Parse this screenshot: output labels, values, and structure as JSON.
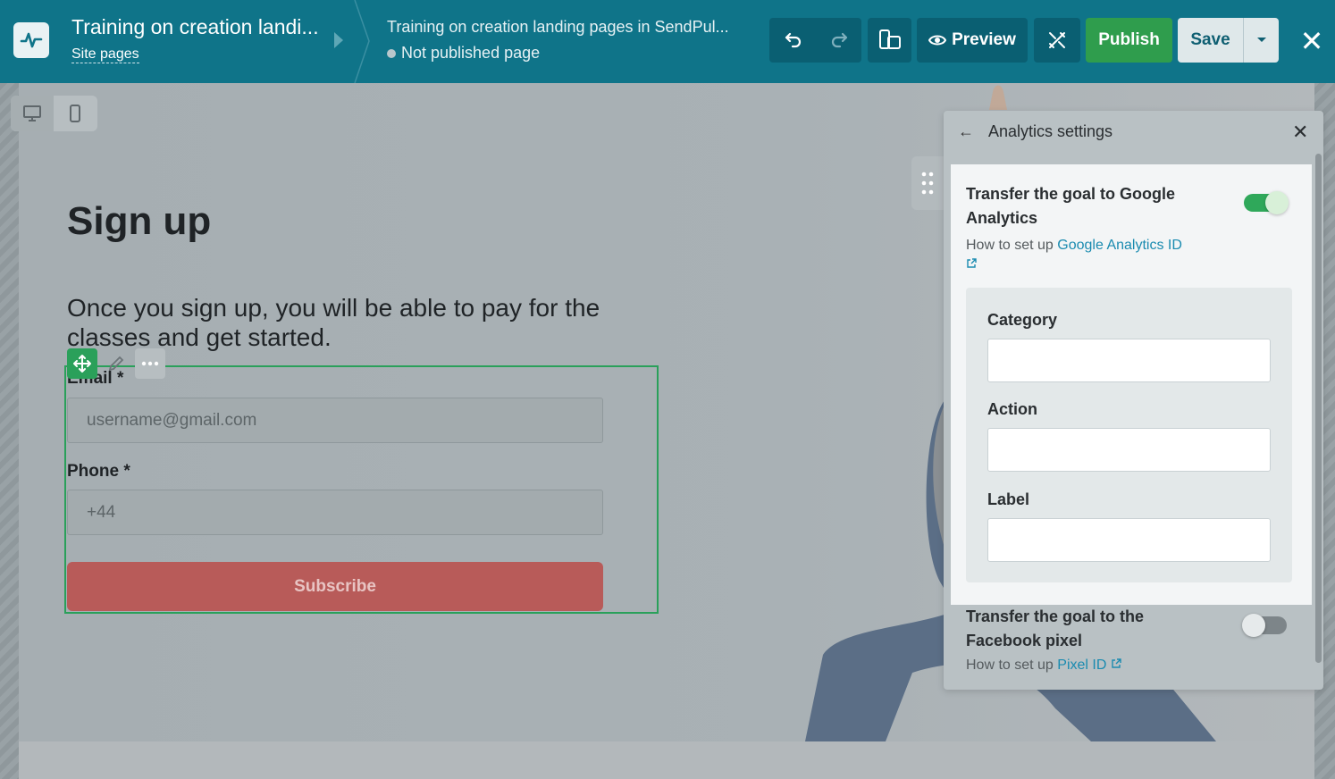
{
  "header": {
    "title": "Training on creation landi...",
    "site_pages": "Site pages",
    "page_name": "Training on creation landing pages in SendPul...",
    "page_status": "Not published page",
    "preview_label": "Preview",
    "publish_label": "Publish",
    "save_label": "Save",
    "close_glyph": "✕"
  },
  "canvas": {
    "heading": "Sign up",
    "intro": "Once you sign up, you will be able to pay for the classes and get started.",
    "form": {
      "email_label": "Email *",
      "email_placeholder": "username@gmail.com",
      "phone_label": "Phone *",
      "phone_placeholder": "+44",
      "submit_label": "Subscribe"
    }
  },
  "panel": {
    "back_glyph": "←",
    "title": "Analytics settings",
    "close_glyph": "✕",
    "ga": {
      "title": "Transfer the goal to Google Analytics",
      "help_prefix": "How to set up ",
      "help_link": "Google Analytics ID",
      "enabled": true,
      "fields": {
        "category_label": "Category",
        "action_label": "Action",
        "label_label": "Label"
      }
    },
    "fb": {
      "title": "Transfer the goal to the Facebook pixel",
      "help_prefix": "How to set up ",
      "help_link": "Pixel ID",
      "enabled": false
    }
  },
  "colors": {
    "topbar": "#0f7489",
    "publish": "#2f9d4d",
    "accent_link": "#1a8bb0",
    "subscribe": "#b85b59",
    "selection": "#2aa05a"
  }
}
